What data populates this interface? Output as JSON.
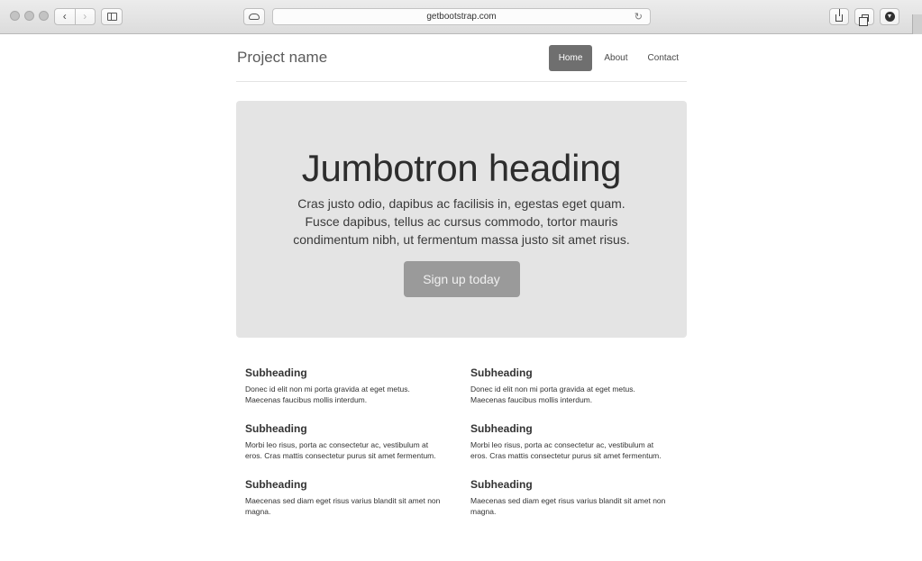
{
  "browser": {
    "url": "getbootstrap.com",
    "back_glyph": "‹",
    "forward_glyph": "›",
    "reload_glyph": "↻"
  },
  "header": {
    "brand": "Project name",
    "nav": [
      {
        "label": "Home",
        "active": true
      },
      {
        "label": "About",
        "active": false
      },
      {
        "label": "Contact",
        "active": false
      }
    ]
  },
  "jumbotron": {
    "heading": "Jumbotron heading",
    "lead": "Cras justo odio, dapibus ac facilisis in, egestas eget quam. Fusce dapibus, tellus ac cursus commodo, tortor mauris condimentum nibh, ut fermentum massa justo sit amet risus.",
    "button": "Sign up today"
  },
  "marketing": [
    {
      "heading": "Subheading",
      "text": "Donec id elit non mi porta gravida at eget metus. Maecenas faucibus mollis interdum."
    },
    {
      "heading": "Subheading",
      "text": "Donec id elit non mi porta gravida at eget metus. Maecenas faucibus mollis interdum."
    },
    {
      "heading": "Subheading",
      "text": "Morbi leo risus, porta ac consectetur ac, vestibulum at eros. Cras mattis consectetur purus sit amet fermentum."
    },
    {
      "heading": "Subheading",
      "text": "Morbi leo risus, porta ac consectetur ac, vestibulum at eros. Cras mattis consectetur purus sit amet fermentum."
    },
    {
      "heading": "Subheading",
      "text": "Maecenas sed diam eget risus varius blandit sit amet non magna."
    },
    {
      "heading": "Subheading",
      "text": "Maecenas sed diam eget risus varius blandit sit amet non magna."
    }
  ],
  "colors": {
    "nav_active": "#6f6f6f",
    "jumbotron_bg": "#e4e4e4",
    "button_bg": "#9a9a9a"
  }
}
